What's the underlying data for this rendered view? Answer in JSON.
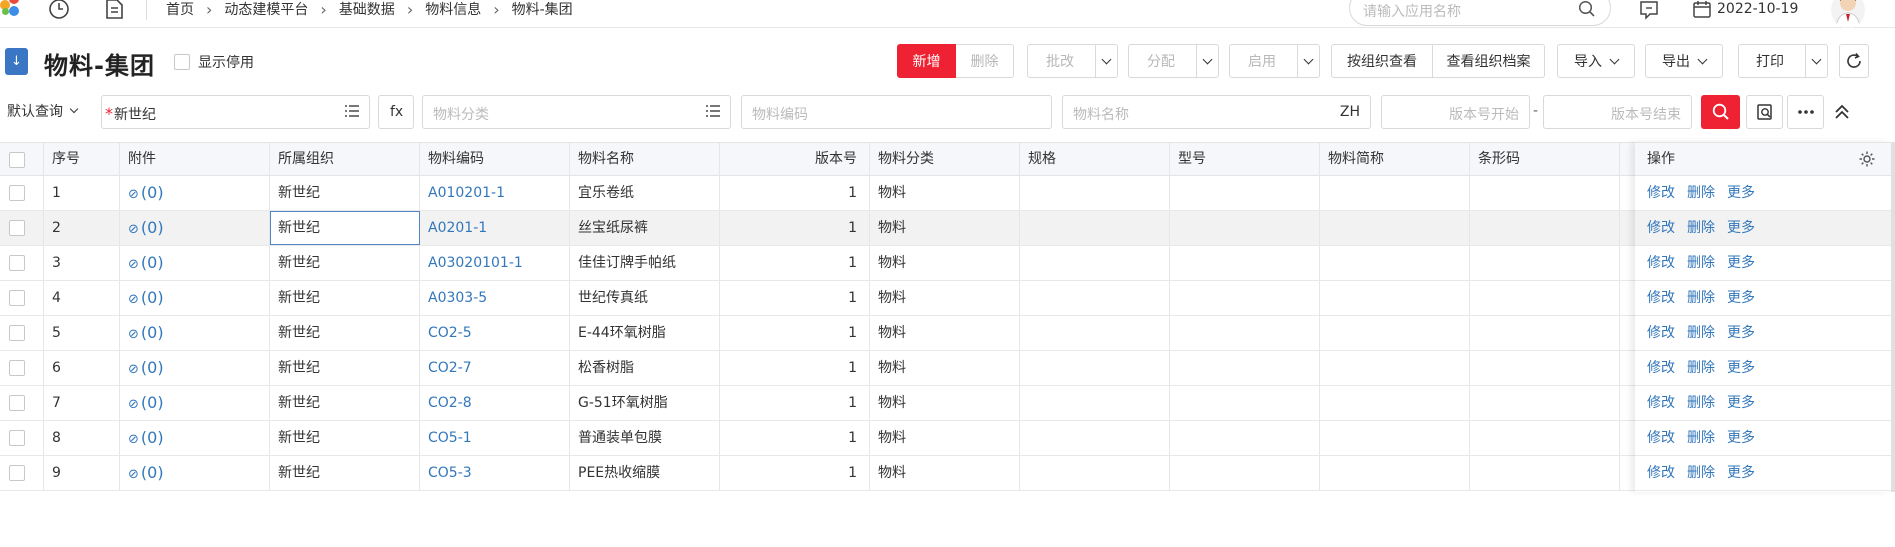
{
  "header": {
    "breadcrumb": [
      "首页",
      "动态建模平台",
      "基础数据",
      "物料信息",
      "物料-集团"
    ],
    "search_placeholder": "请输入应用名称",
    "date": "2022-10-19"
  },
  "page": {
    "title": "物料-集团",
    "show_disabled_label": "显示停用"
  },
  "toolbar": {
    "new": "新增",
    "delete": "删除",
    "batch_edit": "批改",
    "assign": "分配",
    "enable": "启用",
    "view_by_org": "按组织查看",
    "view_org_archive": "查看组织档案",
    "import": "导入",
    "export": "导出",
    "print": "打印"
  },
  "query": {
    "query_name": "默认查询",
    "org_value": "新世纪",
    "fx_label": "fx",
    "category_placeholder": "物料分类",
    "code_placeholder": "物料编码",
    "name_placeholder": "物料名称",
    "name_lang": "ZH",
    "version_start_placeholder": "版本号开始",
    "version_end_placeholder": "版本号结束",
    "range_dash": "-"
  },
  "table": {
    "columns": [
      "序号",
      "附件",
      "所属组织",
      "物料编码",
      "物料名称",
      "版本号",
      "物料分类",
      "规格",
      "型号",
      "物料简称",
      "条形码"
    ],
    "operation_header": "操作",
    "rows": [
      {
        "no": "1",
        "attach": "(0)",
        "org": "新世纪",
        "code": "A010201-1",
        "name": "宜乐卷纸",
        "version": "1",
        "category": "物料"
      },
      {
        "no": "2",
        "attach": "(0)",
        "org": "新世纪",
        "code": "A0201-1",
        "name": "丝宝纸尿裤",
        "version": "1",
        "category": "物料"
      },
      {
        "no": "3",
        "attach": "(0)",
        "org": "新世纪",
        "code": "A03020101-1",
        "name": "佳佳订牌手帕纸",
        "version": "1",
        "category": "物料"
      },
      {
        "no": "4",
        "attach": "(0)",
        "org": "新世纪",
        "code": "A0303-5",
        "name": "世纪传真纸",
        "version": "1",
        "category": "物料"
      },
      {
        "no": "5",
        "attach": "(0)",
        "org": "新世纪",
        "code": "CO2-5",
        "name": "E-44环氧树脂",
        "version": "1",
        "category": "物料"
      },
      {
        "no": "6",
        "attach": "(0)",
        "org": "新世纪",
        "code": "CO2-7",
        "name": "松香树脂",
        "version": "1",
        "category": "物料"
      },
      {
        "no": "7",
        "attach": "(0)",
        "org": "新世纪",
        "code": "CO2-8",
        "name": "G-51环氧树脂",
        "version": "1",
        "category": "物料"
      },
      {
        "no": "8",
        "attach": "(0)",
        "org": "新世纪",
        "code": "CO5-1",
        "name": "普通装单包膜",
        "version": "1",
        "category": "物料"
      },
      {
        "no": "9",
        "attach": "(0)",
        "org": "新世纪",
        "code": "CO5-3",
        "name": "PEE热收缩膜",
        "version": "1",
        "category": "物料"
      }
    ],
    "row_actions": {
      "edit": "修改",
      "delete": "删除",
      "more": "更多"
    }
  },
  "colors": {
    "accent_red": "#ee2233",
    "link_blue": "#3377bb",
    "title_badge_blue": "#3a76c4"
  }
}
